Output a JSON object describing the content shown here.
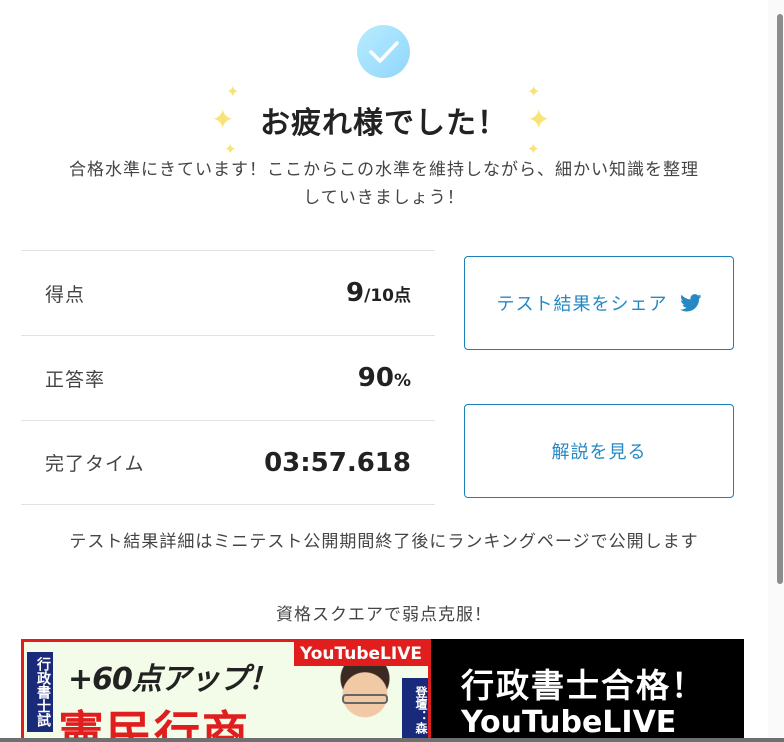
{
  "header": {
    "check_icon": "checkmark-icon",
    "title": "お疲れ様でした！",
    "message_line1": "合格水準にきています！ここからこの水準を維持しながら、細かい知識を整理",
    "message_line2": "していきましょう！"
  },
  "results": {
    "rows": [
      {
        "label": "得点",
        "value": "9",
        "unit": "/10点"
      },
      {
        "label": "正答率",
        "value": "90",
        "unit": "%"
      },
      {
        "label": "完了タイム",
        "value": "03:57.618",
        "unit": ""
      }
    ]
  },
  "actions": {
    "share_label": "テスト結果をシェア",
    "share_icon": "twitter-icon",
    "explain_label": "解説を見る"
  },
  "notice": "テスト結果詳細はミニテスト公開期間終了後にランキングページで公開します",
  "promo": {
    "text": "資格スクエアで弱点克服！",
    "banner": {
      "badge": "YouTubeLIVE",
      "vertical_tag": "行政書士試",
      "headline": "+60点アップ！",
      "big_text": "憲民行商",
      "host_tag": "登壇：森",
      "right_line1": "行政書士合格！",
      "right_line2": "YouTubeLIVE"
    }
  },
  "colors": {
    "accent": "#2789c4",
    "check_circle": "#a6e3fd",
    "sparkle": "#f7e37a",
    "banner_red": "#e01e1e"
  }
}
